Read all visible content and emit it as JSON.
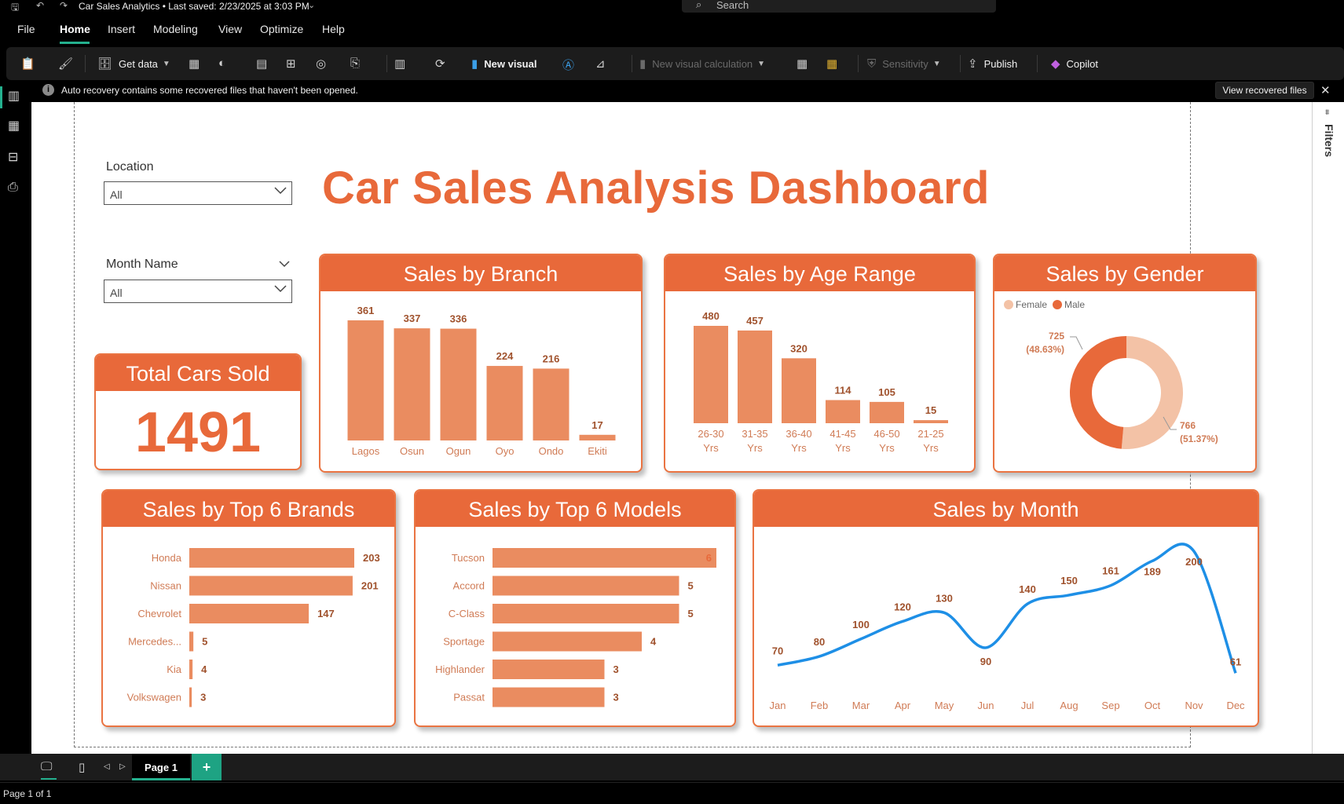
{
  "titlebar": {
    "save_icon": "save-icon",
    "undo_icon": "undo-icon",
    "redo_icon": "redo-icon",
    "title": "Car Sales Analytics • Last saved: 2/23/2025 at 3:03 PM",
    "search_placeholder": "Search"
  },
  "menu": [
    "File",
    "Home",
    "Insert",
    "Modeling",
    "View",
    "Optimize",
    "Help"
  ],
  "menu_active": "Home",
  "ribbon": {
    "get_data": "Get data",
    "new_visual": "New visual",
    "new_visual_calc": "New visual calculation",
    "sensitivity": "Sensitivity",
    "publish": "Publish",
    "copilot": "Copilot"
  },
  "notice": {
    "text": "Auto recovery contains some recovered files that haven't been opened.",
    "button": "View recovered files"
  },
  "filters_label": "Filters",
  "slicers": {
    "location": {
      "label": "Location",
      "value": "All"
    },
    "month": {
      "label": "Month Name",
      "value": "All"
    }
  },
  "dashboard_title": "Car Sales Analysis Dashboard",
  "kpi": {
    "title": "Total Cars Sold",
    "value": "1491"
  },
  "colors": {
    "accent": "#e8693a",
    "bar": "#ea8c60",
    "female": "#f3c2a6",
    "male": "#e8693a",
    "line": "#1e8fe6"
  },
  "chart_data": [
    {
      "type": "bar",
      "title": "Sales by Branch",
      "categories": [
        "Lagos",
        "Osun",
        "Ogun",
        "Oyo",
        "Ondo",
        "Ekiti"
      ],
      "values": [
        361,
        337,
        336,
        224,
        216,
        17
      ]
    },
    {
      "type": "bar",
      "title": "Sales by Age Range",
      "categories": [
        "26-30 Yrs",
        "31-35 Yrs",
        "36-40 Yrs",
        "41-45 Yrs",
        "46-50 Yrs",
        "21-25 Yrs"
      ],
      "values": [
        480,
        457,
        320,
        114,
        105,
        15
      ]
    },
    {
      "type": "pie",
      "title": "Sales by Gender",
      "categories": [
        "Female",
        "Male"
      ],
      "values": [
        766,
        725
      ],
      "labels": [
        "766 (51.37%)",
        "725 (48.63%)"
      ],
      "legend": "top-left"
    },
    {
      "type": "bar",
      "orientation": "horizontal",
      "title": "Sales by Top 6 Brands",
      "categories": [
        "Honda",
        "Nissan",
        "Chevrolet",
        "Mercedes...",
        "Kia",
        "Volkswagen"
      ],
      "values": [
        203,
        201,
        147,
        5,
        4,
        3
      ]
    },
    {
      "type": "bar",
      "orientation": "horizontal",
      "title": "Sales by Top 6 Models",
      "categories": [
        "Tucson",
        "Accord",
        "C-Class",
        "Sportage",
        "Highlander",
        "Passat"
      ],
      "values": [
        6,
        5,
        5,
        4,
        3,
        3
      ]
    },
    {
      "type": "line",
      "title": "Sales by Month",
      "categories": [
        "Jan",
        "Feb",
        "Mar",
        "Apr",
        "May",
        "Jun",
        "Jul",
        "Aug",
        "Sep",
        "Oct",
        "Nov",
        "Dec"
      ],
      "values": [
        70,
        80,
        100,
        120,
        130,
        90,
        140,
        150,
        161,
        189,
        200,
        61
      ]
    }
  ],
  "page": {
    "tab": "Page 1",
    "add": "+",
    "status": "Page 1 of 1"
  }
}
